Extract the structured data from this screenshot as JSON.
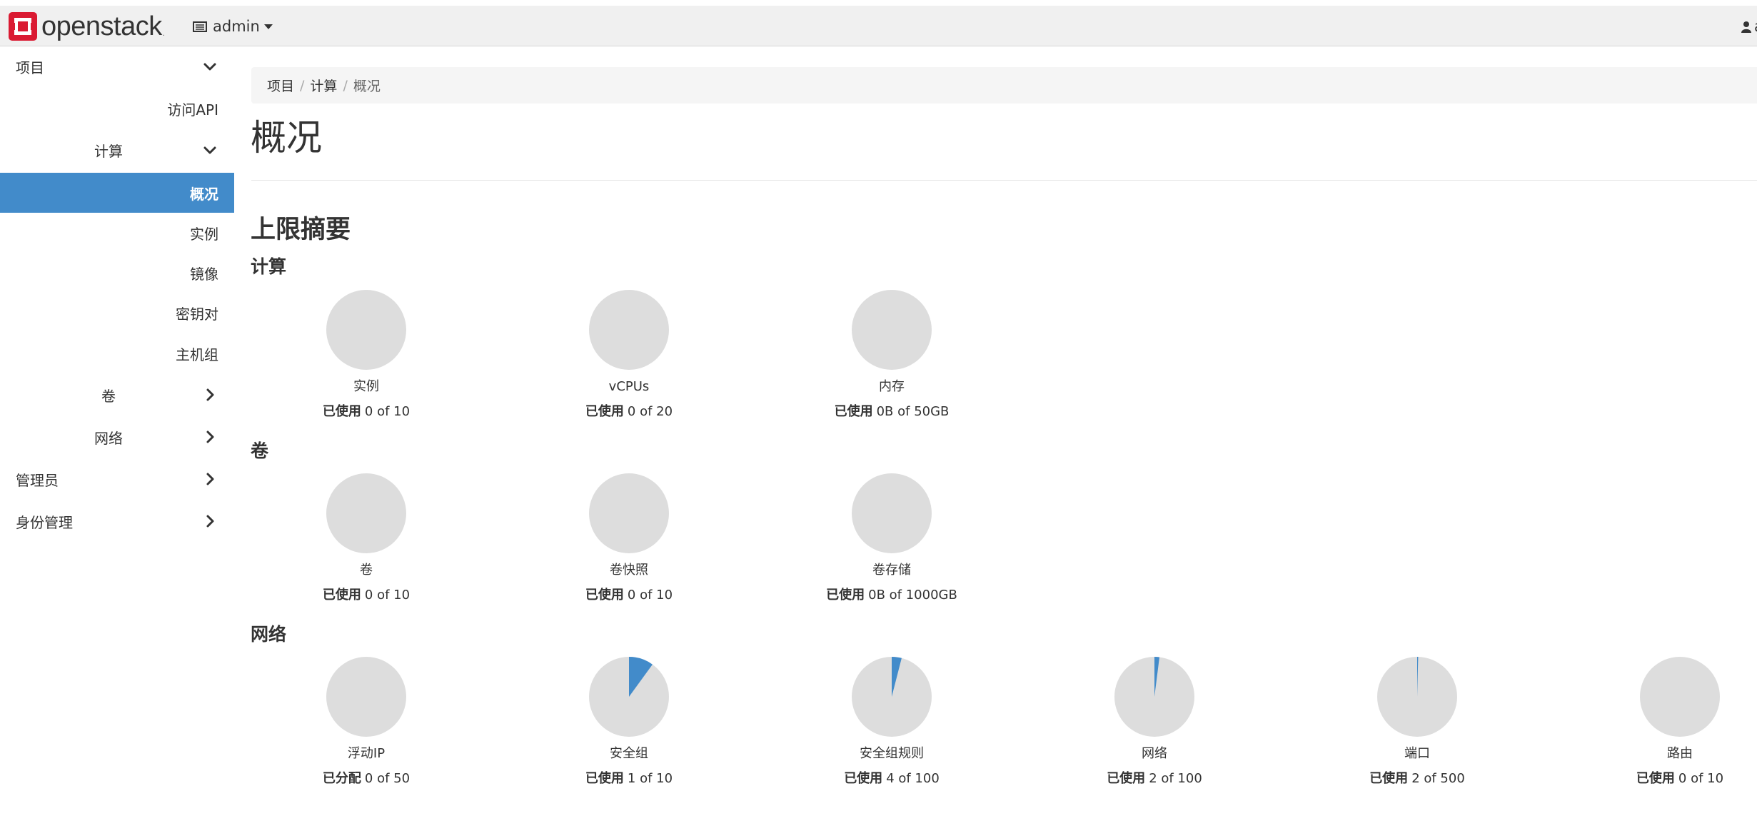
{
  "colors": {
    "accent": "#428bca",
    "pie_bg": "#dddddd",
    "brand": "#da1a32"
  },
  "header": {
    "brand": "openstack",
    "brand_mark": ".",
    "project": "admin",
    "user": "ad"
  },
  "sidebar": {
    "items": [
      {
        "label": "项目",
        "icon": "chevron-down-icon"
      },
      {
        "label": "访问API"
      },
      {
        "label": "计算",
        "icon": "chevron-down-icon"
      },
      {
        "label": "概况",
        "active": true
      },
      {
        "label": "实例"
      },
      {
        "label": "镜像"
      },
      {
        "label": "密钥对"
      },
      {
        "label": "主机组"
      },
      {
        "label": "卷",
        "icon": "chevron-right-icon"
      },
      {
        "label": "网络",
        "icon": "chevron-right-icon"
      },
      {
        "label": "管理员",
        "icon": "chevron-right-icon"
      },
      {
        "label": "身份管理",
        "icon": "chevron-right-icon"
      }
    ]
  },
  "breadcrumb": {
    "items": [
      "项目",
      "计算"
    ],
    "current": "概况",
    "separator": "/"
  },
  "page": {
    "title": "概况",
    "section": "上限摘要"
  },
  "groups": [
    {
      "title": "计算",
      "quotas": [
        {
          "label": "实例",
          "used_label": "已使用",
          "used": 0,
          "total": 10,
          "used_text": "0 of 10"
        },
        {
          "label": "vCPUs",
          "used_label": "已使用",
          "used": 0,
          "total": 20,
          "used_text": "0 of 20"
        },
        {
          "label": "内存",
          "used_label": "已使用",
          "used": 0,
          "total": 50,
          "used_text": "0B of 50GB"
        }
      ]
    },
    {
      "title": "卷",
      "quotas": [
        {
          "label": "卷",
          "used_label": "已使用",
          "used": 0,
          "total": 10,
          "used_text": "0 of 10"
        },
        {
          "label": "卷快照",
          "used_label": "已使用",
          "used": 0,
          "total": 10,
          "used_text": "0 of 10"
        },
        {
          "label": "卷存储",
          "used_label": "已使用",
          "used": 0,
          "total": 1000,
          "used_text": "0B of 1000GB"
        }
      ]
    },
    {
      "title": "网络",
      "quotas": [
        {
          "label": "浮动IP",
          "used_label": "已分配",
          "used": 0,
          "total": 50,
          "used_text": "0 of 50"
        },
        {
          "label": "安全组",
          "used_label": "已使用",
          "used": 1,
          "total": 10,
          "used_text": "1 of 10"
        },
        {
          "label": "安全组规则",
          "used_label": "已使用",
          "used": 4,
          "total": 100,
          "used_text": "4 of 100"
        },
        {
          "label": "网络",
          "used_label": "已使用",
          "used": 2,
          "total": 100,
          "used_text": "2 of 100"
        },
        {
          "label": "端口",
          "used_label": "已使用",
          "used": 2,
          "total": 500,
          "used_text": "2 of 500"
        },
        {
          "label": "路由",
          "used_label": "已使用",
          "used": 0,
          "total": 10,
          "used_text": "0 of 10"
        }
      ]
    }
  ]
}
